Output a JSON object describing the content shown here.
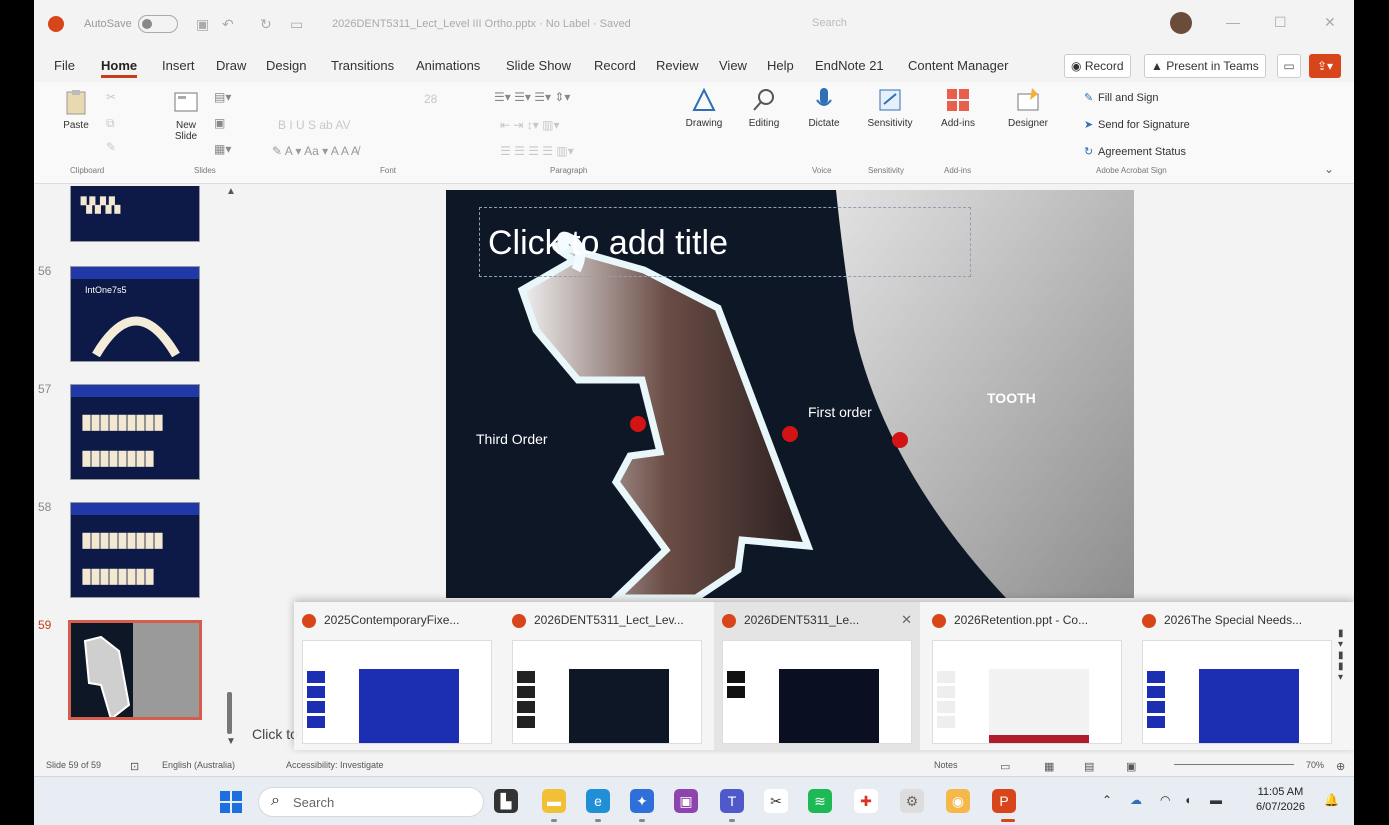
{
  "titlebar": {
    "autosave_label": "AutoSave",
    "doc_title": "2026DENT5311_Lect_Level III Ortho.pptx · No Label · Saved",
    "search_placeholder": "Search"
  },
  "menu": {
    "tabs": [
      "File",
      "Home",
      "Insert",
      "Draw",
      "Design",
      "Transitions",
      "Animations",
      "Slide Show",
      "Record",
      "Review",
      "View",
      "Help",
      "EndNote 21",
      "Content Manager"
    ],
    "active_tab": "Home",
    "record_label": "Record",
    "present_label": "Present in Teams"
  },
  "ribbon": {
    "paste": "Paste",
    "new_slide": "New Slide",
    "font_size": "28",
    "drawing": "Drawing",
    "editing": "Editing",
    "dictate": "Dictate",
    "sensitivity": "Sensitivity",
    "addins": "Add-ins",
    "designer": "Designer",
    "fill_sign": "Fill and Sign",
    "send_signature": "Send for Signature",
    "agreement_status": "Agreement Status",
    "groups": {
      "clipboard": "Clipboard",
      "slides": "Slides",
      "font": "Font",
      "paragraph": "Paragraph",
      "voice": "Voice",
      "sensitivity": "Sensitivity",
      "addins": "Add-ins",
      "adobe": "Adobe Acrobat Sign"
    }
  },
  "thumbnails": [
    {
      "num": "",
      "kind": "partial"
    },
    {
      "num": "56",
      "kind": "arch",
      "title": "IntOne7s5"
    },
    {
      "num": "57",
      "kind": "teeth"
    },
    {
      "num": "58",
      "kind": "teeth"
    },
    {
      "num": "59",
      "kind": "current"
    }
  ],
  "slide": {
    "title_placeholder": "Click to add title",
    "label_third": "Third Order",
    "label_first": "First order",
    "label_tooth": "TOOTH"
  },
  "notes_hint": "Click to add notes",
  "previews": [
    {
      "title": "2025ContemporaryFixe...",
      "hover": false
    },
    {
      "title": "2026DENT5311_Lect_Lev...",
      "hover": false
    },
    {
      "title": "2026DENT5311_Le...",
      "hover": true
    },
    {
      "title": "2026Retention.ppt - Co...",
      "hover": false
    },
    {
      "title": "2026The Special Needs...",
      "hover": false
    }
  ],
  "statusbar": {
    "slide_count": "Slide 59 of 59",
    "language": "English (Australia)",
    "accessibility": "Accessibility: Investigate",
    "notes": "Notes",
    "zoom": "70%"
  },
  "taskbar": {
    "search_placeholder": "Search",
    "time": "11:05 AM",
    "date": "6/07/2026"
  },
  "colors": {
    "accent": "#c43e1c",
    "slide_bg": "#0d1726",
    "thumb_blue": "#1c2fb3",
    "dot_red": "#d21414"
  }
}
